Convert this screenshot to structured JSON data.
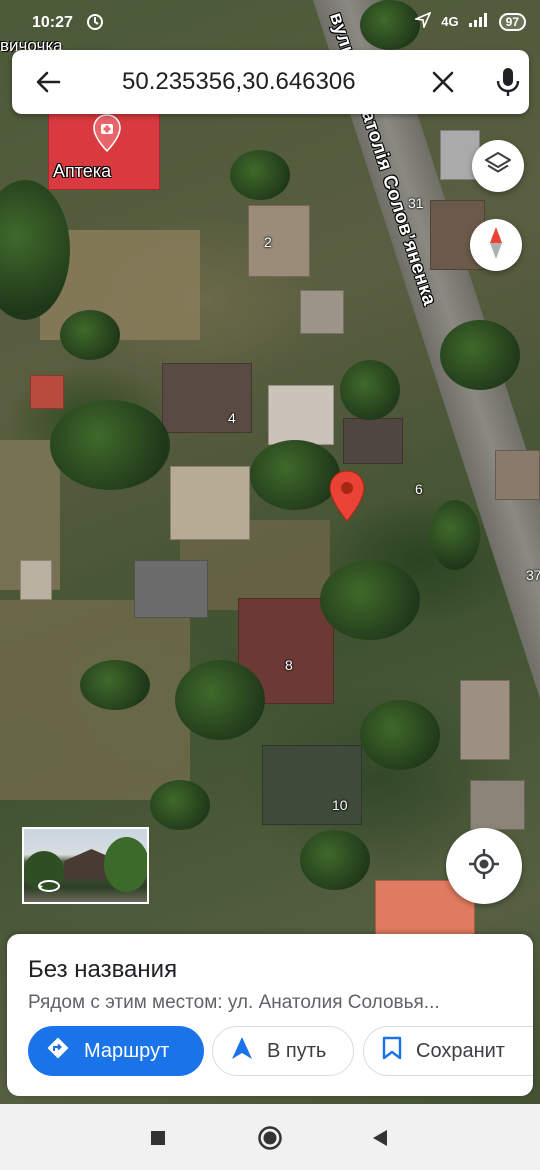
{
  "status_bar": {
    "time": "10:27",
    "signal": "4G",
    "battery": "97"
  },
  "map": {
    "partial_top_label": "вичочка",
    "street_name": "вулиця Анатолія Соловʼяненка",
    "poi_label": "Аптека",
    "house_numbers": [
      "2",
      "4",
      "6",
      "8",
      "10",
      "31",
      "37"
    ]
  },
  "search": {
    "query": "50.235356,30.646306",
    "back_icon": "arrow-back-icon",
    "clear_icon": "close-icon",
    "mic_icon": "microphone-icon"
  },
  "controls": {
    "layers_icon": "layers-icon",
    "compass_icon": "compass-icon",
    "my_location_icon": "my-location-icon",
    "street_view_icon": "street-view-rotate-icon"
  },
  "place_sheet": {
    "title": "Без названия",
    "subtitle": "Рядом с этим местом: ул. Анатолия Соловья...",
    "actions": [
      {
        "label": "Маршрут",
        "icon": "directions-icon"
      },
      {
        "label": "В путь",
        "icon": "navigation-arrow-icon"
      },
      {
        "label": "Сохранит",
        "icon": "bookmark-icon"
      }
    ]
  },
  "colors": {
    "primary_blue": "#1a73e8",
    "pin_red": "#ea4335",
    "pharmacy_red": "#d93a3f"
  }
}
